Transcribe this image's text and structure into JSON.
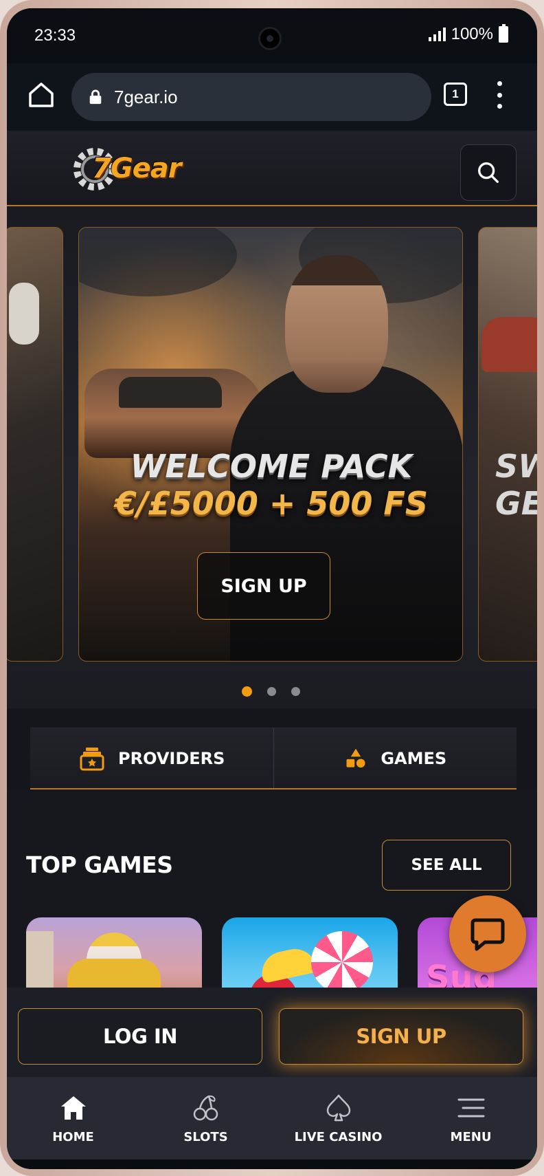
{
  "status": {
    "time": "23:33",
    "battery": "100%"
  },
  "browser": {
    "url": "7gear.io",
    "tab_count": "1"
  },
  "site": {
    "logo_text": "7Gear"
  },
  "banner": {
    "title_line1": "WELCOME PACK",
    "title_line2": "€/£5000 + 500 FS",
    "cta": "SIGN UP",
    "next_slide_text_line1": "SW",
    "next_slide_text_line2": "GE",
    "slide_count": 3,
    "active_slide": 1
  },
  "categories": [
    {
      "label": "PROVIDERS",
      "icon": "providers-icon"
    },
    {
      "label": "GAMES",
      "icon": "games-shapes-icon"
    }
  ],
  "top_games": {
    "title": "TOP GAMES",
    "see_all": "SEE ALL",
    "visible_text": "Sug"
  },
  "auth": {
    "login": "LOG IN",
    "signup": "SIGN UP"
  },
  "bottom_nav": [
    {
      "label": "HOME",
      "icon": "home-icon"
    },
    {
      "label": "SLOTS",
      "icon": "cherries-icon"
    },
    {
      "label": "LIVE CASINO",
      "icon": "spade-icon"
    },
    {
      "label": "MENU",
      "icon": "menu-icon"
    }
  ],
  "colors": {
    "accent": "#f39c12",
    "gold_border": "#c98a35",
    "background": "#17181d"
  }
}
